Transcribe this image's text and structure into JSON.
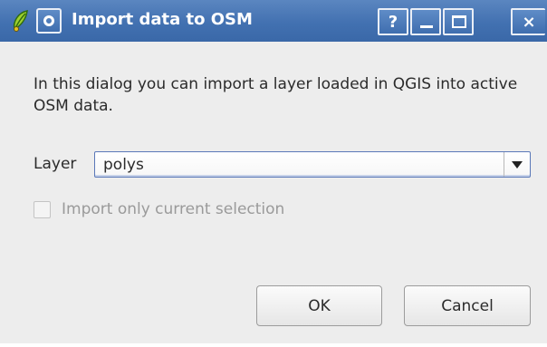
{
  "window": {
    "title": "Import data to OSM",
    "titlebar_buttons": {
      "help": "?",
      "close": "×"
    },
    "icons": {
      "app": "qgis-leaf-icon",
      "menu": "window-menu-icon",
      "help": "help-icon",
      "minimize": "minimize-icon",
      "maximize": "maximize-icon",
      "close": "close-icon"
    }
  },
  "dialog": {
    "description": "In this dialog you can import a layer loaded in QGIS into active OSM data.",
    "layer_label": "Layer",
    "layer_value": "polys",
    "selection_checkbox": {
      "label": "Import only current selection",
      "checked": false,
      "enabled": false
    },
    "ok_label": "OK",
    "cancel_label": "Cancel"
  },
  "colors": {
    "titlebar": "#4271b1",
    "dialog_background": "#ededed",
    "combo_border": "#5a78b8",
    "disabled_text": "#9a9a9a"
  }
}
